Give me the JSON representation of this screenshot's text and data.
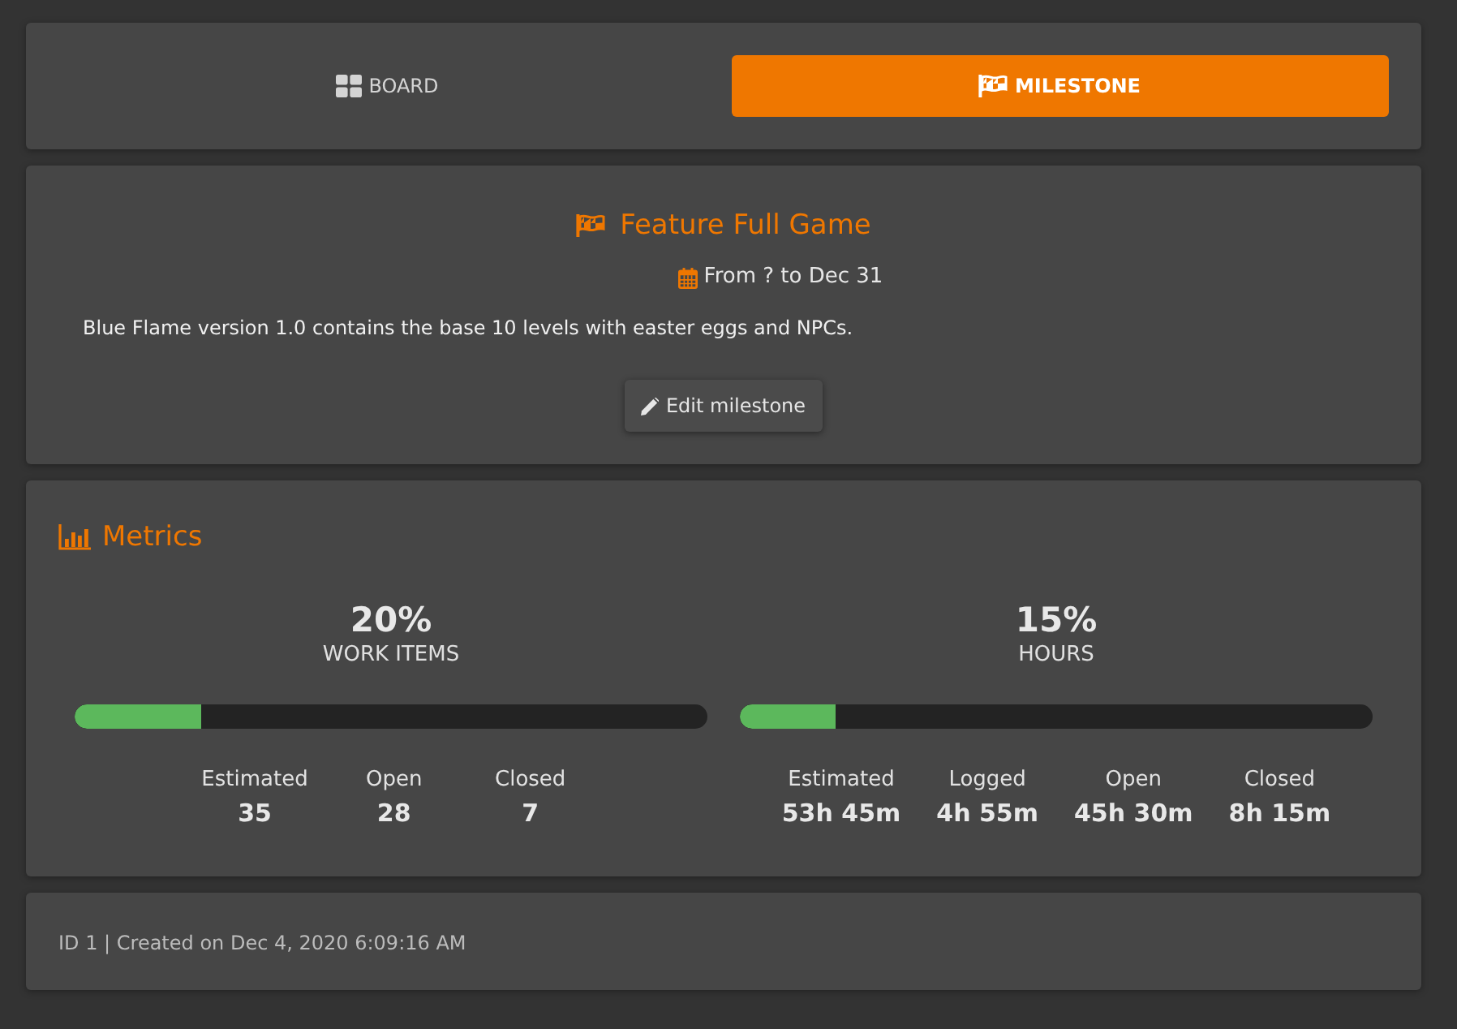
{
  "tabs": [
    {
      "label": "BOARD",
      "selected": false
    },
    {
      "label": "MILESTONE",
      "selected": true
    }
  ],
  "milestone": {
    "title": "Feature Full Game",
    "dates": "From ? to Dec 31",
    "description": "Blue Flame version 1.0 contains the base 10 levels with easter eggs and NPCs.",
    "edit_button": "Edit milestone"
  },
  "metrics": {
    "title": "Metrics",
    "groups": [
      {
        "percent": "20%",
        "label": "WORK ITEMS",
        "level": 0.2,
        "stats": [
          {
            "label": "Estimated",
            "value": "35"
          },
          {
            "label": "Open",
            "value": "28"
          },
          {
            "label": "Closed",
            "value": "7"
          }
        ]
      },
      {
        "percent": "15%",
        "label": "HOURS",
        "level": 0.15,
        "stats": [
          {
            "label": "Estimated",
            "value": "53h 45m"
          },
          {
            "label": "Logged",
            "value": "4h 55m"
          },
          {
            "label": "Open",
            "value": "45h 30m"
          },
          {
            "label": "Closed",
            "value": "8h 15m"
          }
        ]
      }
    ]
  },
  "footer": {
    "text": "ID 1 | Created on Dec 4, 2020 6:09:16 AM"
  }
}
